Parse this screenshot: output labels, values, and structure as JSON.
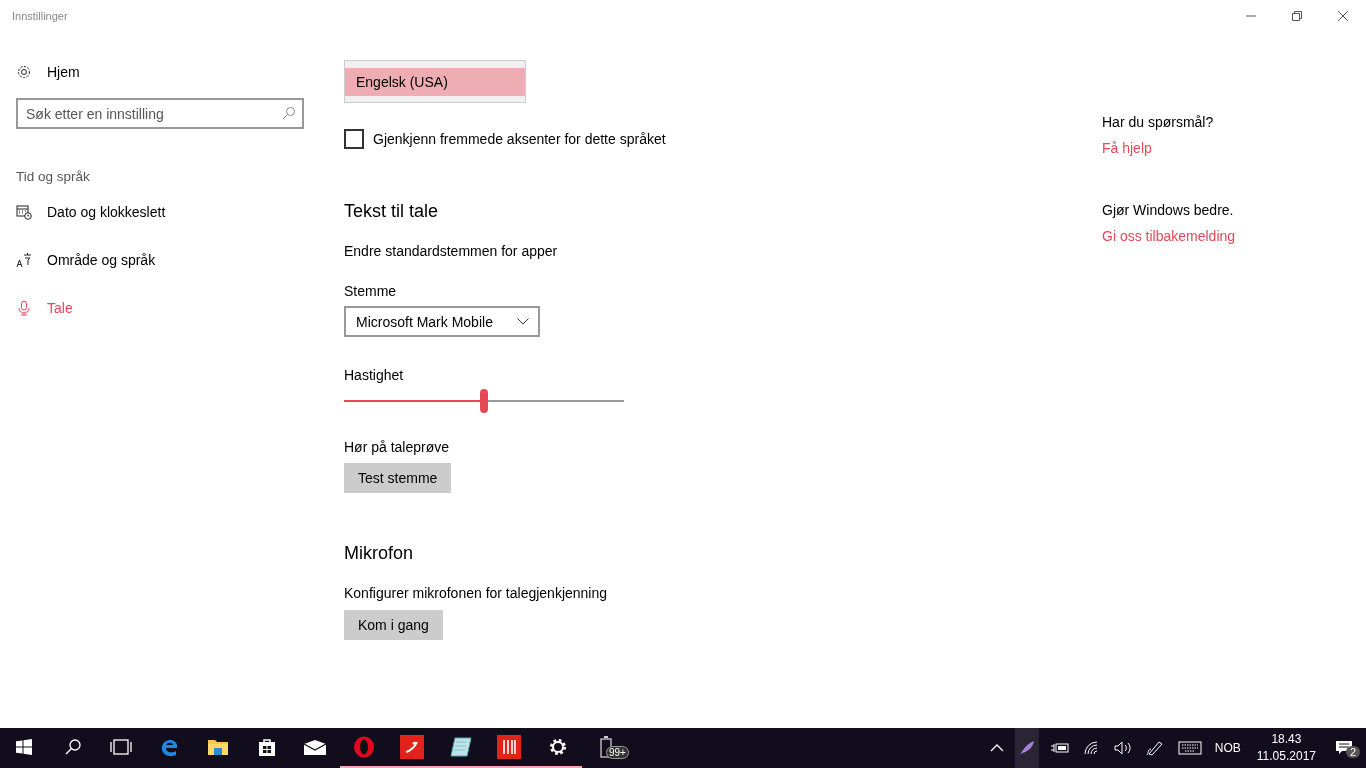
{
  "window": {
    "title": "Innstillinger"
  },
  "sidebar": {
    "home": "Hjem",
    "search": {
      "placeholder": "Søk etter en innstilling"
    },
    "section": "Tid og språk",
    "items": [
      {
        "label": "Dato og klokkeslett",
        "kind": "calendar",
        "selected": false
      },
      {
        "label": "Område og språk",
        "kind": "language",
        "selected": false
      },
      {
        "label": "Tale",
        "kind": "microphone",
        "selected": true
      }
    ]
  },
  "language_list": [
    {
      "label": "Engelsk (USA)",
      "selected": true
    }
  ],
  "accent_checkbox": {
    "label": "Gjenkjenn fremmede aksenter for dette språket",
    "checked": false
  },
  "tts": {
    "heading": "Tekst til tale",
    "description": "Endre standardstemmen for apper",
    "voice_label": "Stemme",
    "voice_value": "Microsoft Mark Mobile",
    "speed_label": "Hastighet",
    "speed": {
      "level": 0.5
    },
    "preview_label": "Hør på taleprøve",
    "preview_button": "Test stemme"
  },
  "microphone": {
    "heading": "Mikrofon",
    "description": "Konfigurer mikrofonen for talegjenkjenning",
    "button": "Kom i gang"
  },
  "help": {
    "question": "Har du spørsmål?",
    "help_link": "Få hjelp",
    "feedback_prompt": "Gjør Windows bedre.",
    "feedback_link": "Gi oss tilbakemelding"
  },
  "taskbar": {
    "apps": [
      {
        "kind": "start",
        "open": false
      },
      {
        "kind": "search",
        "open": false
      },
      {
        "kind": "taskview",
        "open": false
      },
      {
        "kind": "edge",
        "open": false
      },
      {
        "kind": "explorer",
        "open": false
      },
      {
        "kind": "store",
        "open": false
      },
      {
        "kind": "mail",
        "open": false
      },
      {
        "kind": "opera",
        "open": true
      },
      {
        "kind": "redapp",
        "open": true
      },
      {
        "kind": "notepad",
        "open": true
      },
      {
        "kind": "mixer",
        "open": true
      },
      {
        "kind": "settings",
        "open": true
      },
      {
        "kind": "battery",
        "open": false,
        "badge": "99+"
      }
    ],
    "language": "NOB",
    "time": "18.43",
    "date": "11.05.2017",
    "notifications": "2"
  }
}
